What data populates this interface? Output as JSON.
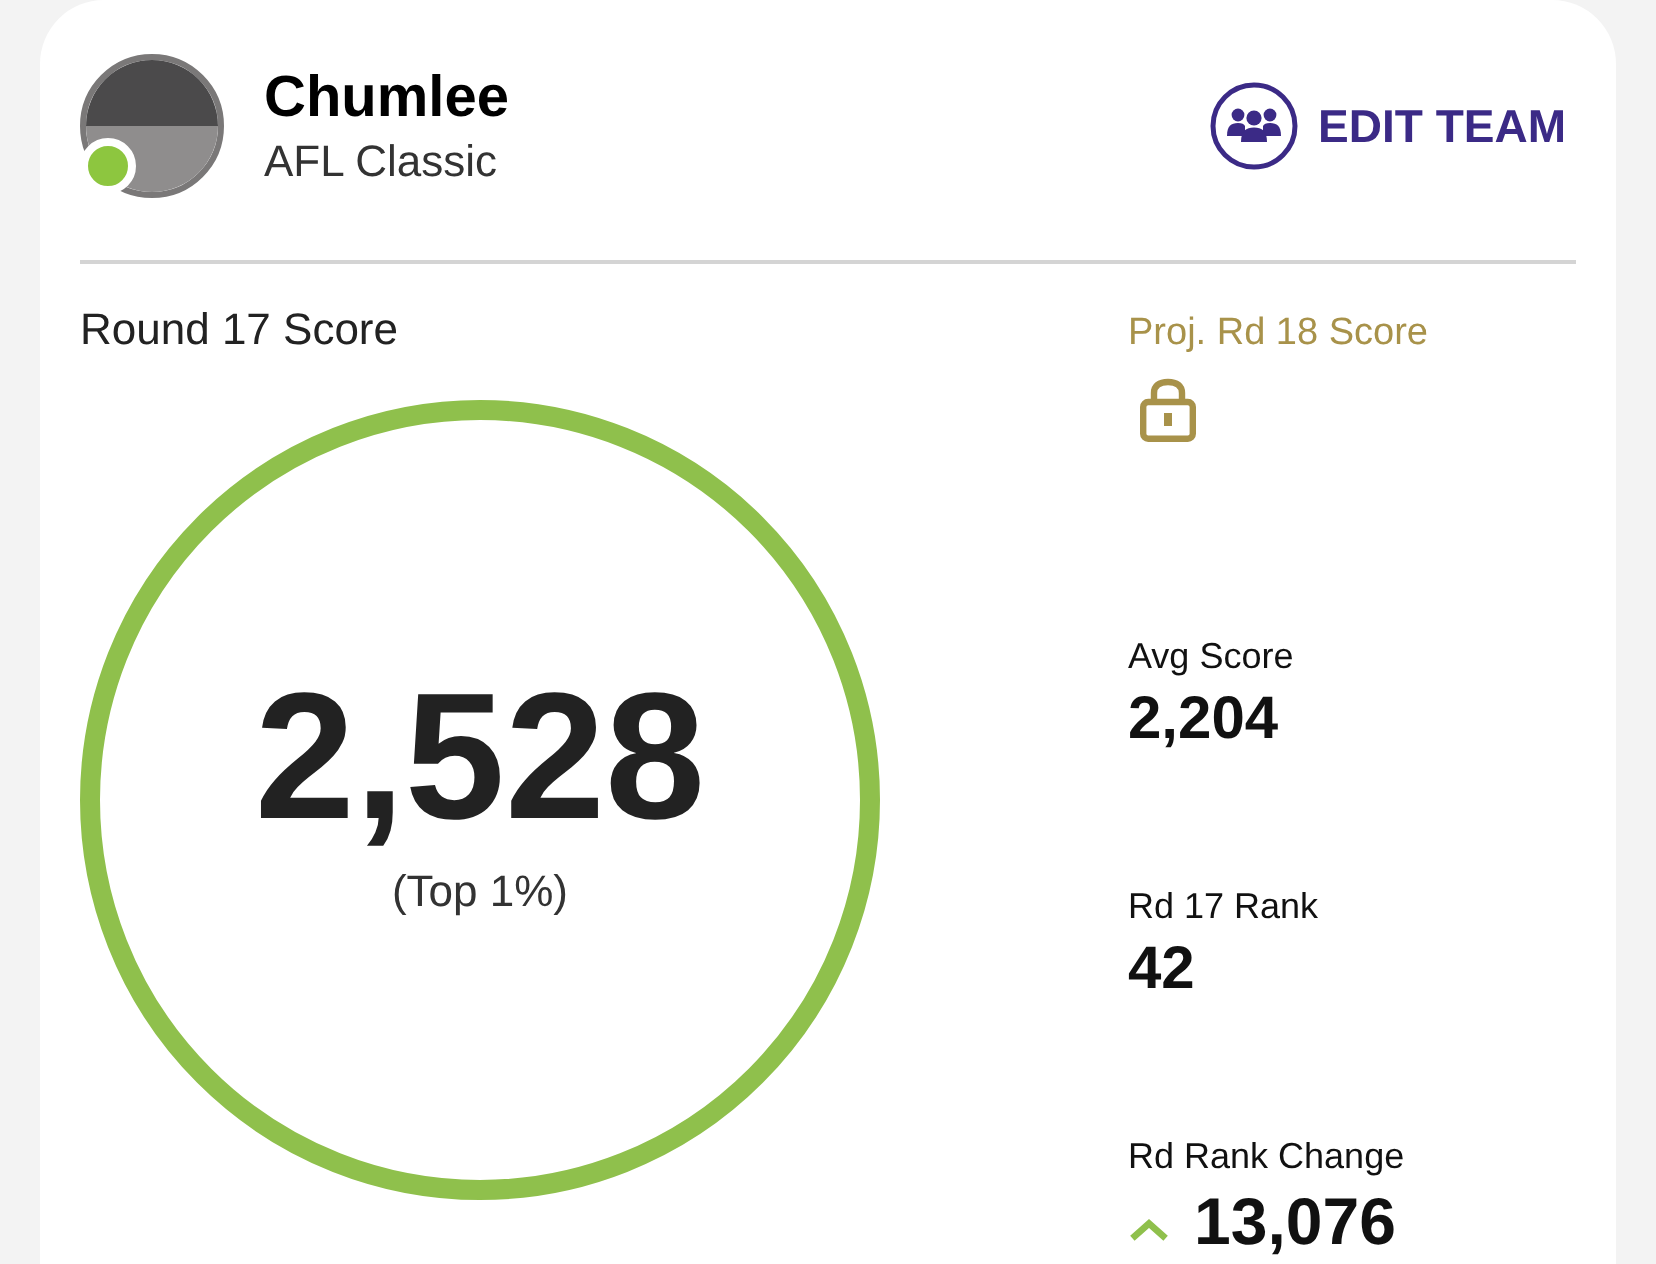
{
  "team": {
    "name": "Chumlee",
    "competition": "AFL Classic",
    "online": true
  },
  "edit_button": {
    "label": "EDIT TEAM"
  },
  "score": {
    "label": "Round 17 Score",
    "value": "2,528",
    "percentile": "(Top 1%)"
  },
  "projected": {
    "label": "Proj. Rd 18 Score",
    "locked": true
  },
  "stats": [
    {
      "label": "Avg Score",
      "value": "2,204",
      "kind": "plain"
    },
    {
      "label": "Rd 17 Rank",
      "value": "42",
      "kind": "plain"
    },
    {
      "label": "Rd Rank Change",
      "value": "13,076",
      "kind": "rising"
    }
  ]
}
